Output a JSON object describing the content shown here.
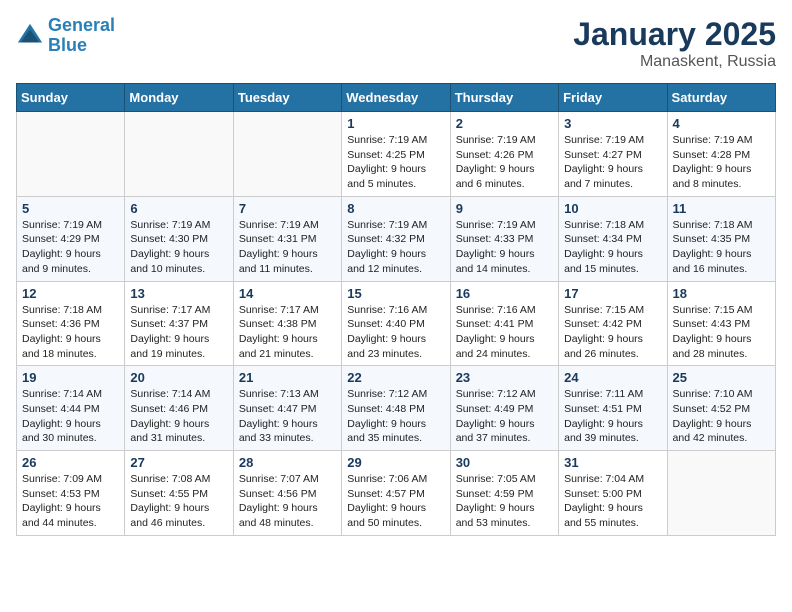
{
  "logo": {
    "line1": "General",
    "line2": "Blue"
  },
  "title": "January 2025",
  "subtitle": "Manaskent, Russia",
  "weekdays": [
    "Sunday",
    "Monday",
    "Tuesday",
    "Wednesday",
    "Thursday",
    "Friday",
    "Saturday"
  ],
  "weeks": [
    [
      {
        "day": "",
        "sunrise": "",
        "sunset": "",
        "daylight": ""
      },
      {
        "day": "",
        "sunrise": "",
        "sunset": "",
        "daylight": ""
      },
      {
        "day": "",
        "sunrise": "",
        "sunset": "",
        "daylight": ""
      },
      {
        "day": "1",
        "sunrise": "Sunrise: 7:19 AM",
        "sunset": "Sunset: 4:25 PM",
        "daylight": "Daylight: 9 hours and 5 minutes."
      },
      {
        "day": "2",
        "sunrise": "Sunrise: 7:19 AM",
        "sunset": "Sunset: 4:26 PM",
        "daylight": "Daylight: 9 hours and 6 minutes."
      },
      {
        "day": "3",
        "sunrise": "Sunrise: 7:19 AM",
        "sunset": "Sunset: 4:27 PM",
        "daylight": "Daylight: 9 hours and 7 minutes."
      },
      {
        "day": "4",
        "sunrise": "Sunrise: 7:19 AM",
        "sunset": "Sunset: 4:28 PM",
        "daylight": "Daylight: 9 hours and 8 minutes."
      }
    ],
    [
      {
        "day": "5",
        "sunrise": "Sunrise: 7:19 AM",
        "sunset": "Sunset: 4:29 PM",
        "daylight": "Daylight: 9 hours and 9 minutes."
      },
      {
        "day": "6",
        "sunrise": "Sunrise: 7:19 AM",
        "sunset": "Sunset: 4:30 PM",
        "daylight": "Daylight: 9 hours and 10 minutes."
      },
      {
        "day": "7",
        "sunrise": "Sunrise: 7:19 AM",
        "sunset": "Sunset: 4:31 PM",
        "daylight": "Daylight: 9 hours and 11 minutes."
      },
      {
        "day": "8",
        "sunrise": "Sunrise: 7:19 AM",
        "sunset": "Sunset: 4:32 PM",
        "daylight": "Daylight: 9 hours and 12 minutes."
      },
      {
        "day": "9",
        "sunrise": "Sunrise: 7:19 AM",
        "sunset": "Sunset: 4:33 PM",
        "daylight": "Daylight: 9 hours and 14 minutes."
      },
      {
        "day": "10",
        "sunrise": "Sunrise: 7:18 AM",
        "sunset": "Sunset: 4:34 PM",
        "daylight": "Daylight: 9 hours and 15 minutes."
      },
      {
        "day": "11",
        "sunrise": "Sunrise: 7:18 AM",
        "sunset": "Sunset: 4:35 PM",
        "daylight": "Daylight: 9 hours and 16 minutes."
      }
    ],
    [
      {
        "day": "12",
        "sunrise": "Sunrise: 7:18 AM",
        "sunset": "Sunset: 4:36 PM",
        "daylight": "Daylight: 9 hours and 18 minutes."
      },
      {
        "day": "13",
        "sunrise": "Sunrise: 7:17 AM",
        "sunset": "Sunset: 4:37 PM",
        "daylight": "Daylight: 9 hours and 19 minutes."
      },
      {
        "day": "14",
        "sunrise": "Sunrise: 7:17 AM",
        "sunset": "Sunset: 4:38 PM",
        "daylight": "Daylight: 9 hours and 21 minutes."
      },
      {
        "day": "15",
        "sunrise": "Sunrise: 7:16 AM",
        "sunset": "Sunset: 4:40 PM",
        "daylight": "Daylight: 9 hours and 23 minutes."
      },
      {
        "day": "16",
        "sunrise": "Sunrise: 7:16 AM",
        "sunset": "Sunset: 4:41 PM",
        "daylight": "Daylight: 9 hours and 24 minutes."
      },
      {
        "day": "17",
        "sunrise": "Sunrise: 7:15 AM",
        "sunset": "Sunset: 4:42 PM",
        "daylight": "Daylight: 9 hours and 26 minutes."
      },
      {
        "day": "18",
        "sunrise": "Sunrise: 7:15 AM",
        "sunset": "Sunset: 4:43 PM",
        "daylight": "Daylight: 9 hours and 28 minutes."
      }
    ],
    [
      {
        "day": "19",
        "sunrise": "Sunrise: 7:14 AM",
        "sunset": "Sunset: 4:44 PM",
        "daylight": "Daylight: 9 hours and 30 minutes."
      },
      {
        "day": "20",
        "sunrise": "Sunrise: 7:14 AM",
        "sunset": "Sunset: 4:46 PM",
        "daylight": "Daylight: 9 hours and 31 minutes."
      },
      {
        "day": "21",
        "sunrise": "Sunrise: 7:13 AM",
        "sunset": "Sunset: 4:47 PM",
        "daylight": "Daylight: 9 hours and 33 minutes."
      },
      {
        "day": "22",
        "sunrise": "Sunrise: 7:12 AM",
        "sunset": "Sunset: 4:48 PM",
        "daylight": "Daylight: 9 hours and 35 minutes."
      },
      {
        "day": "23",
        "sunrise": "Sunrise: 7:12 AM",
        "sunset": "Sunset: 4:49 PM",
        "daylight": "Daylight: 9 hours and 37 minutes."
      },
      {
        "day": "24",
        "sunrise": "Sunrise: 7:11 AM",
        "sunset": "Sunset: 4:51 PM",
        "daylight": "Daylight: 9 hours and 39 minutes."
      },
      {
        "day": "25",
        "sunrise": "Sunrise: 7:10 AM",
        "sunset": "Sunset: 4:52 PM",
        "daylight": "Daylight: 9 hours and 42 minutes."
      }
    ],
    [
      {
        "day": "26",
        "sunrise": "Sunrise: 7:09 AM",
        "sunset": "Sunset: 4:53 PM",
        "daylight": "Daylight: 9 hours and 44 minutes."
      },
      {
        "day": "27",
        "sunrise": "Sunrise: 7:08 AM",
        "sunset": "Sunset: 4:55 PM",
        "daylight": "Daylight: 9 hours and 46 minutes."
      },
      {
        "day": "28",
        "sunrise": "Sunrise: 7:07 AM",
        "sunset": "Sunset: 4:56 PM",
        "daylight": "Daylight: 9 hours and 48 minutes."
      },
      {
        "day": "29",
        "sunrise": "Sunrise: 7:06 AM",
        "sunset": "Sunset: 4:57 PM",
        "daylight": "Daylight: 9 hours and 50 minutes."
      },
      {
        "day": "30",
        "sunrise": "Sunrise: 7:05 AM",
        "sunset": "Sunset: 4:59 PM",
        "daylight": "Daylight: 9 hours and 53 minutes."
      },
      {
        "day": "31",
        "sunrise": "Sunrise: 7:04 AM",
        "sunset": "Sunset: 5:00 PM",
        "daylight": "Daylight: 9 hours and 55 minutes."
      },
      {
        "day": "",
        "sunrise": "",
        "sunset": "",
        "daylight": ""
      }
    ]
  ]
}
